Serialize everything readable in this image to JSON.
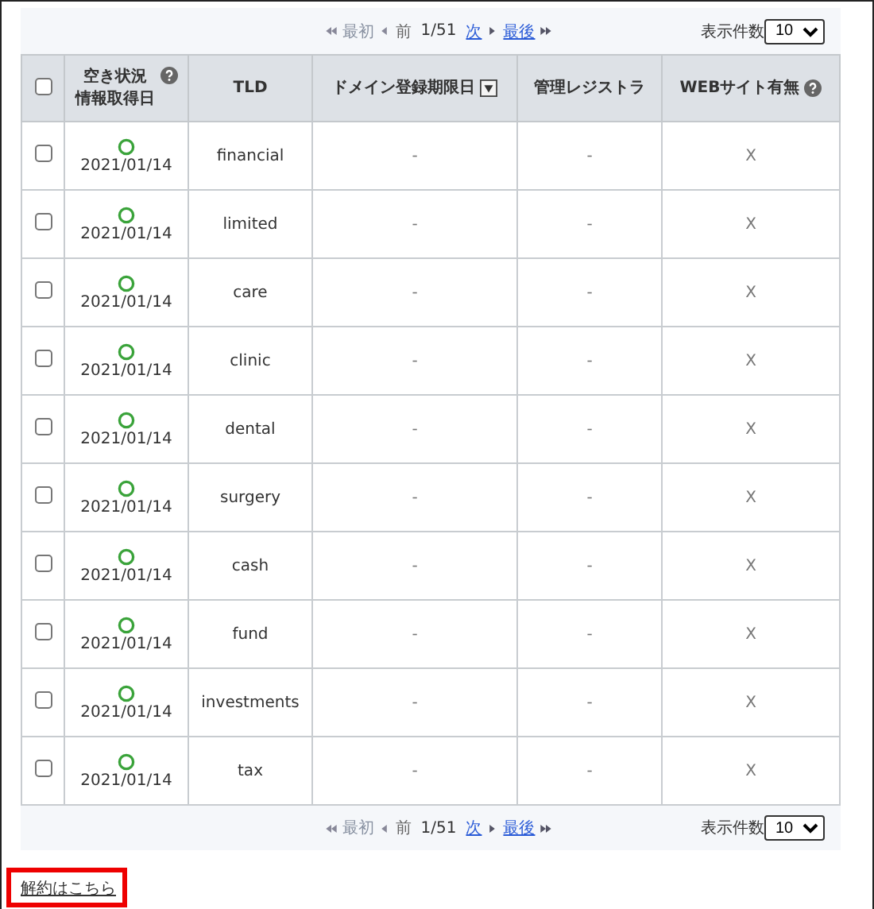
{
  "pagers": [
    {
      "first": {
        "label": "最初",
        "disabled": true
      },
      "prev": {
        "label": "前",
        "disabled": true
      },
      "page": "1/51",
      "next": {
        "label": "次",
        "disabled": false
      },
      "last": {
        "label": "最後",
        "disabled": false
      },
      "per_page_label": "表示件数",
      "per_page": "10"
    },
    {
      "first": {
        "label": "最初",
        "disabled": true
      },
      "prev": {
        "label": "前",
        "disabled": true
      },
      "page": "1/51",
      "next": {
        "label": "次",
        "disabled": false
      },
      "last": {
        "label": "最後",
        "disabled": false
      },
      "per_page_label": "表示件数",
      "per_page": "10"
    }
  ],
  "table": {
    "select_all_checked": false,
    "columns": [
      {
        "lines": [
          "空き状況",
          "情報取得日"
        ],
        "help": true,
        "sort": false
      },
      {
        "lines": [
          "TLD"
        ],
        "help": false,
        "sort": false
      },
      {
        "lines": [
          "ドメイン登録期限日"
        ],
        "help": false,
        "sort": true
      },
      {
        "lines": [
          "管理レジストラ"
        ],
        "help": false,
        "sort": false
      },
      {
        "lines": [
          "WEBサイト有無"
        ],
        "help": true,
        "sort": false
      }
    ],
    "rows": [
      {
        "checked": false,
        "available": true,
        "date": "2021/01/14",
        "tld": "financial",
        "expiry": "-",
        "registrar": "-",
        "website": "X"
      },
      {
        "checked": false,
        "available": true,
        "date": "2021/01/14",
        "tld": "limited",
        "expiry": "-",
        "registrar": "-",
        "website": "X"
      },
      {
        "checked": false,
        "available": true,
        "date": "2021/01/14",
        "tld": "care",
        "expiry": "-",
        "registrar": "-",
        "website": "X"
      },
      {
        "checked": false,
        "available": true,
        "date": "2021/01/14",
        "tld": "clinic",
        "expiry": "-",
        "registrar": "-",
        "website": "X"
      },
      {
        "checked": false,
        "available": true,
        "date": "2021/01/14",
        "tld": "dental",
        "expiry": "-",
        "registrar": "-",
        "website": "X"
      },
      {
        "checked": false,
        "available": true,
        "date": "2021/01/14",
        "tld": "surgery",
        "expiry": "-",
        "registrar": "-",
        "website": "X"
      },
      {
        "checked": false,
        "available": true,
        "date": "2021/01/14",
        "tld": "cash",
        "expiry": "-",
        "registrar": "-",
        "website": "X"
      },
      {
        "checked": false,
        "available": true,
        "date": "2021/01/14",
        "tld": "fund",
        "expiry": "-",
        "registrar": "-",
        "website": "X"
      },
      {
        "checked": false,
        "available": true,
        "date": "2021/01/14",
        "tld": "investments",
        "expiry": "-",
        "registrar": "-",
        "website": "X"
      },
      {
        "checked": false,
        "available": true,
        "date": "2021/01/14",
        "tld": "tax",
        "expiry": "-",
        "registrar": "-",
        "website": "X"
      }
    ]
  },
  "cancel_link": "解約はこちら"
}
